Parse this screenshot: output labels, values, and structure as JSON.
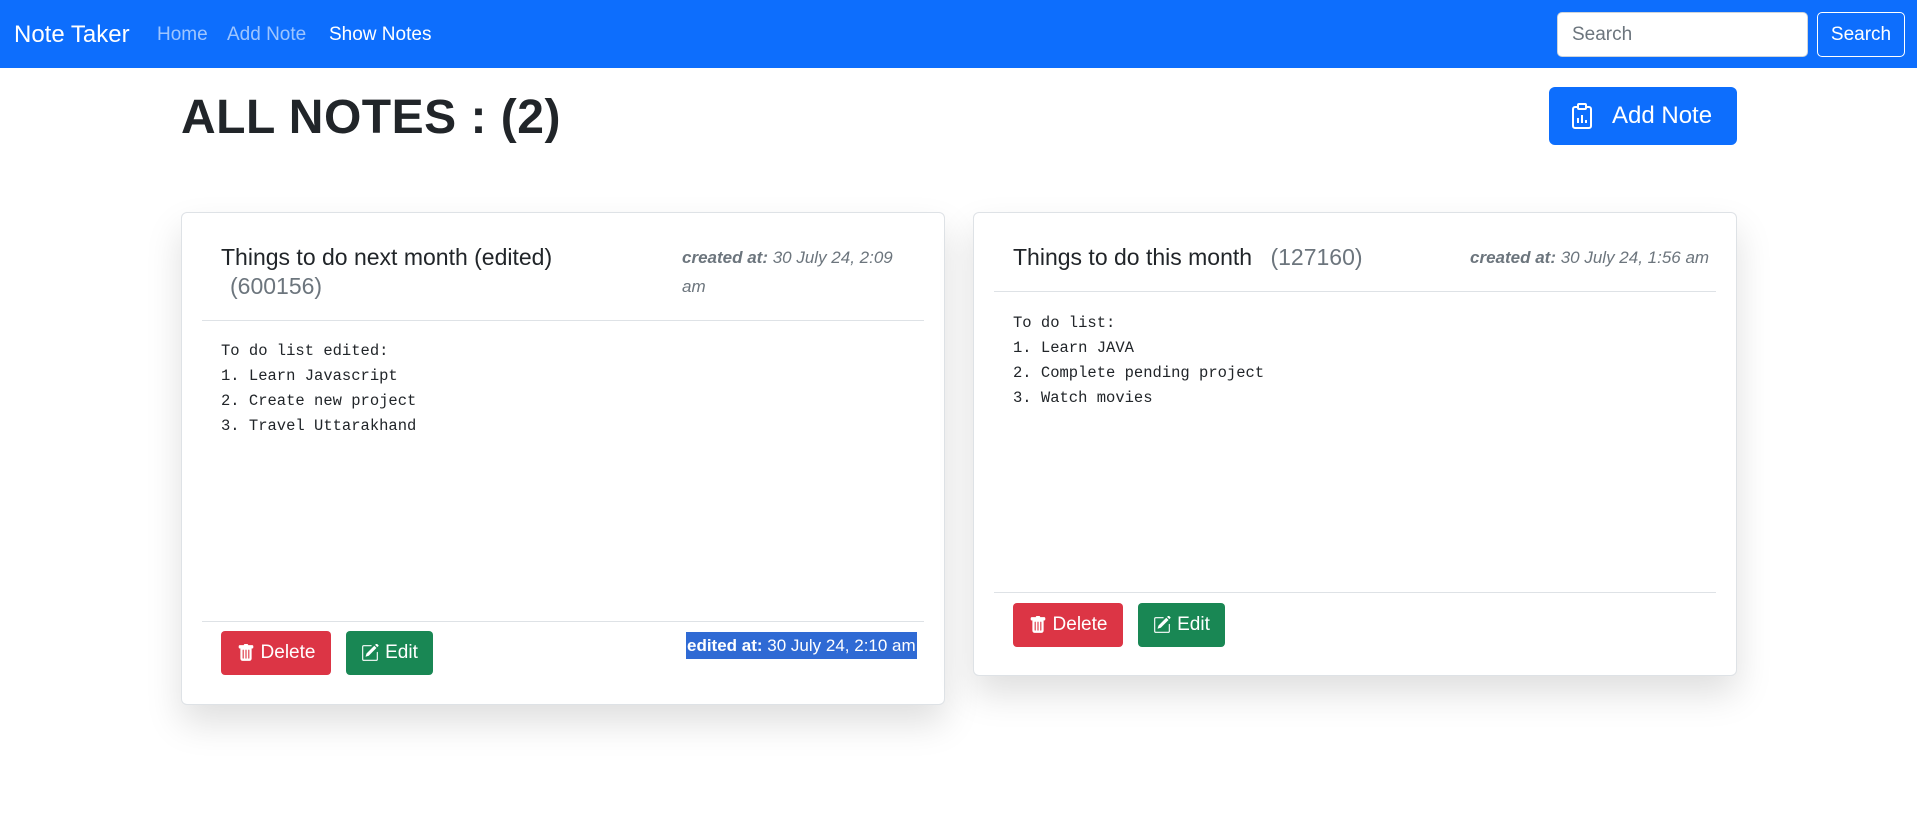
{
  "navbar": {
    "brand": "Note Taker",
    "links": [
      "Home",
      "Add Note",
      "Show Notes"
    ],
    "search_placeholder": "Search",
    "search_button": "Search"
  },
  "header": {
    "title": "ALL NOTES : (2)",
    "add_button": "Add Note"
  },
  "notes": [
    {
      "title": "Things to do next month (edited)",
      "id": "(600156)",
      "created_label": "created at:",
      "created_value": "30 July 24, 2:09 am",
      "body": "To do list edited:\n1. Learn Javascript\n2. Create new project\n3. Travel Uttarakhand",
      "delete_label": "Delete",
      "edit_label": "Edit",
      "edited_label": "edited at:",
      "edited_value": "30 July 24, 2:10 am"
    },
    {
      "title": "Things to do this month",
      "id": "(127160)",
      "created_label": "created at:",
      "created_value": "30 July 24, 1:56 am",
      "body": "To do list:\n1. Learn JAVA\n2. Complete pending project\n3. Watch movies",
      "delete_label": "Delete",
      "edit_label": "Edit"
    }
  ],
  "colors": {
    "primary": "#0d6efd",
    "danger": "#dc3545",
    "success": "#198754",
    "selection": "#2f6ad4"
  }
}
